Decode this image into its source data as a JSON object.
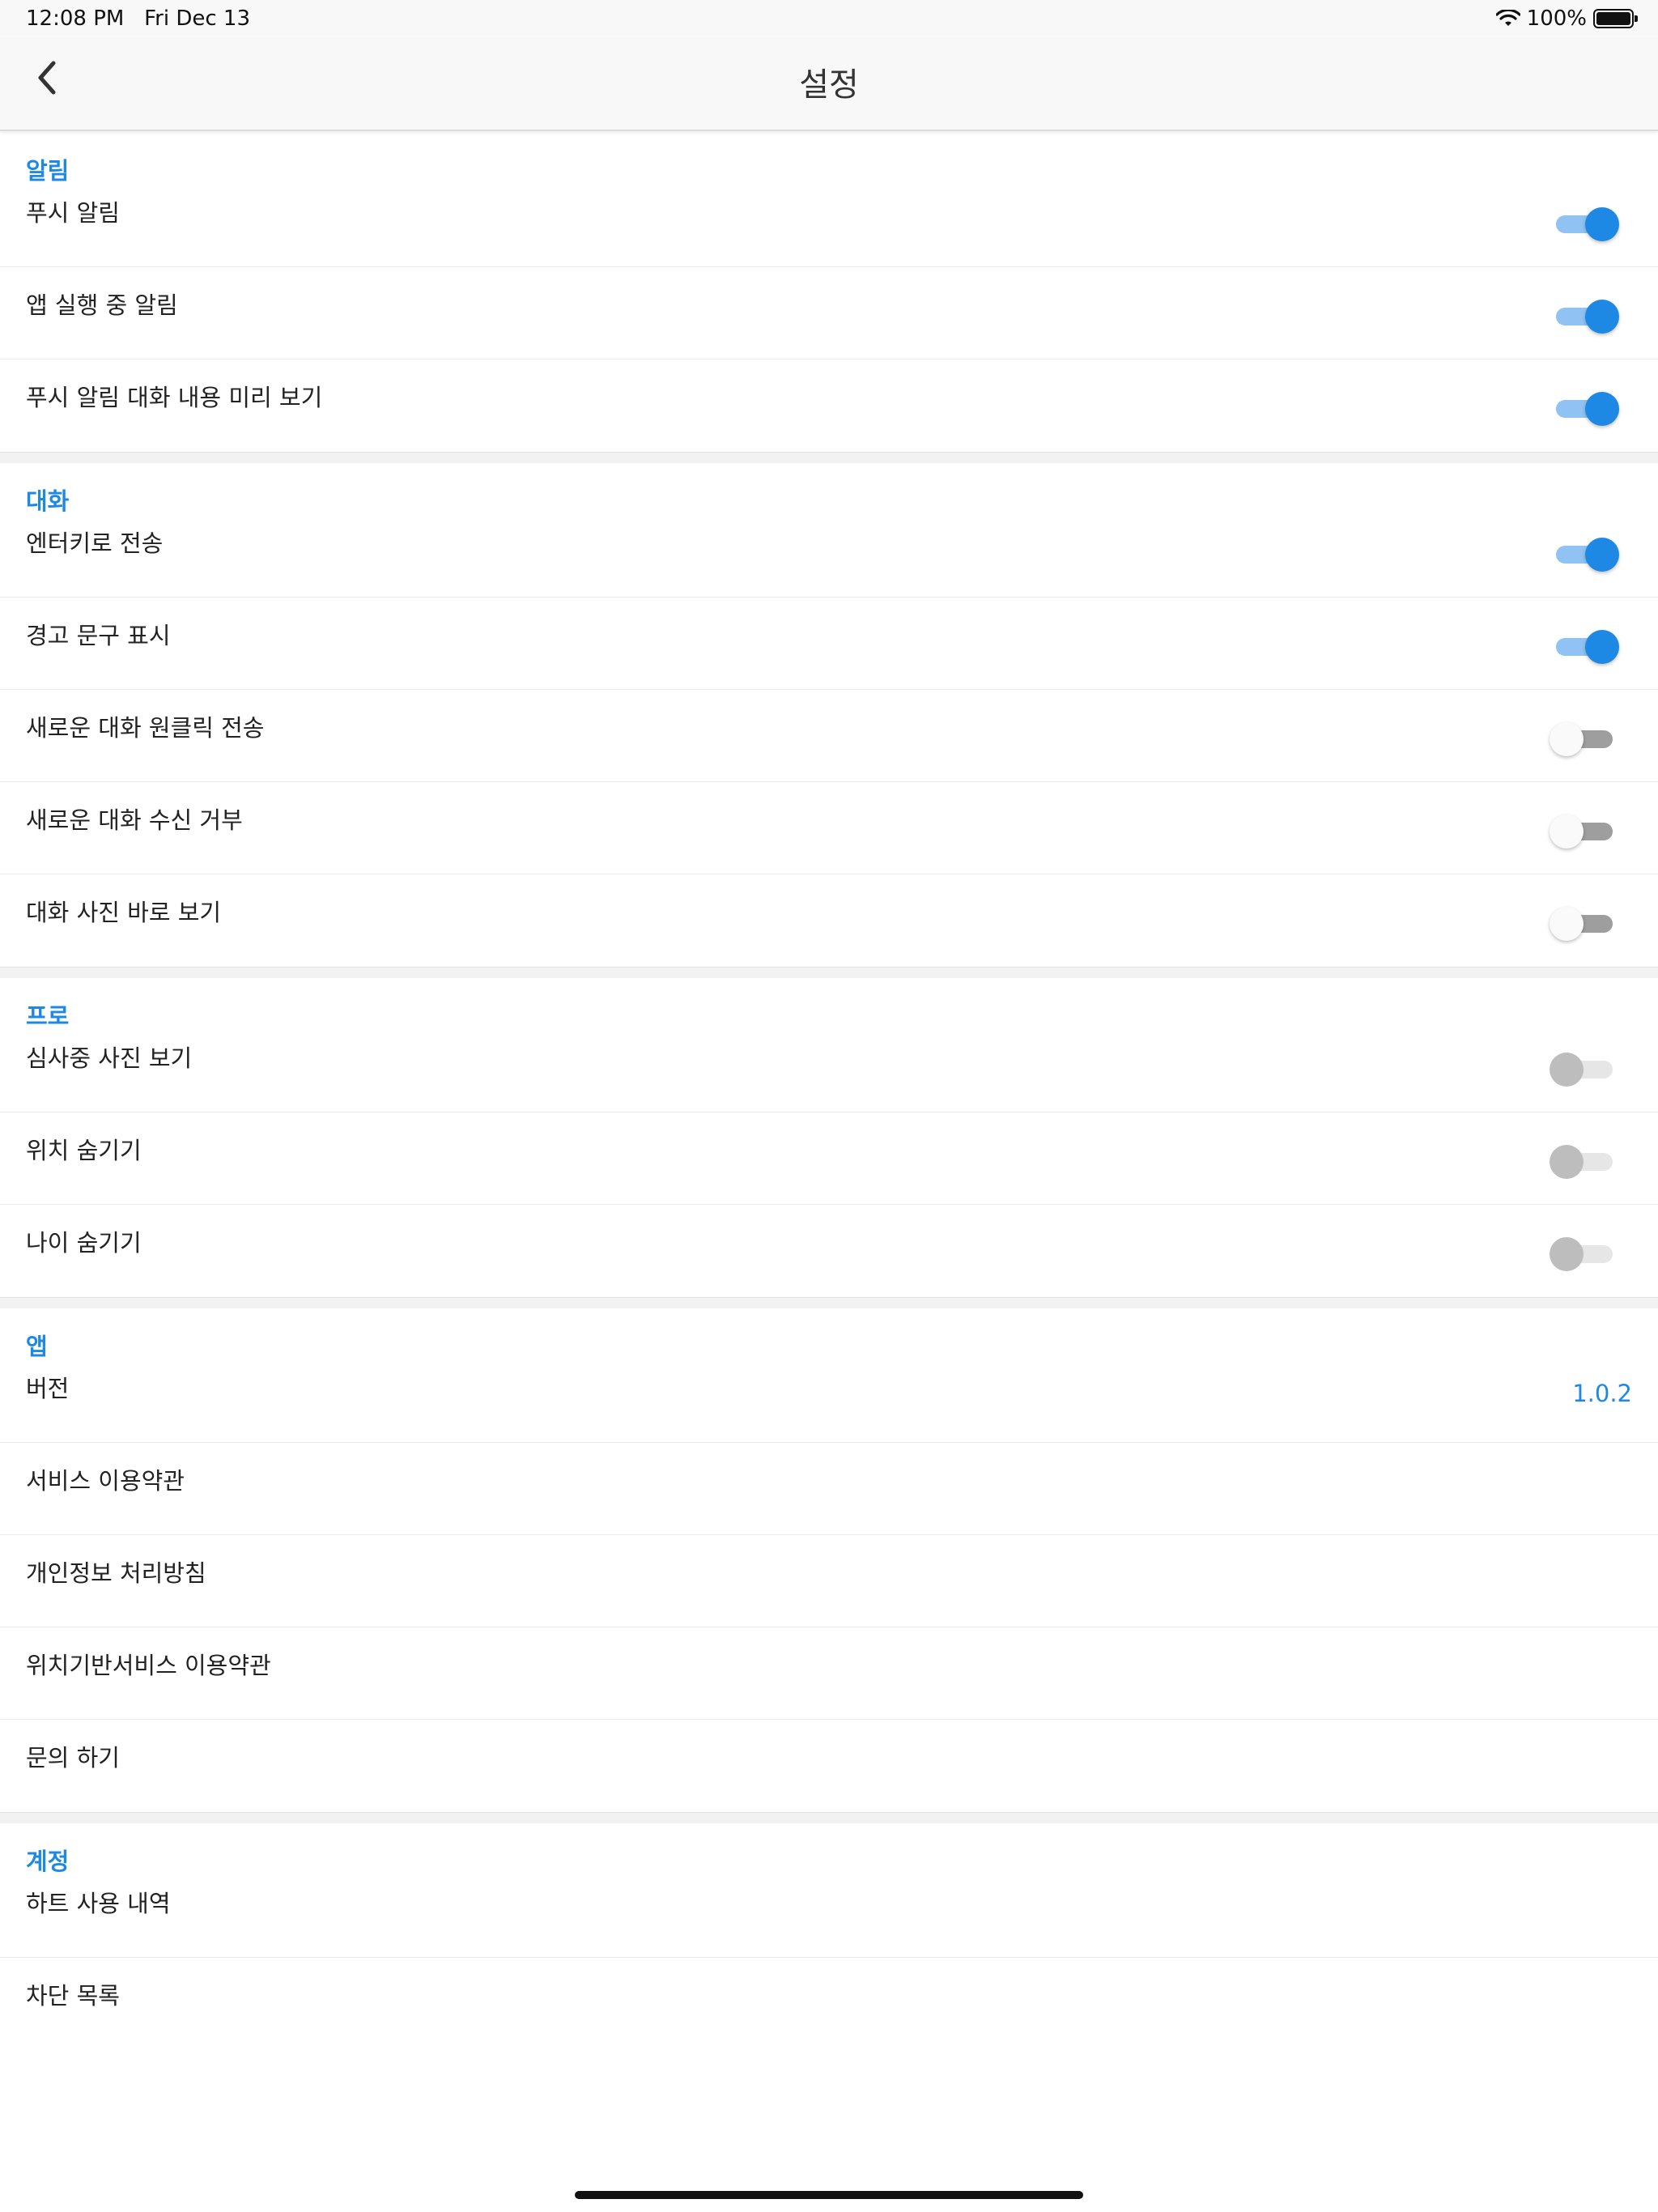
{
  "status_bar": {
    "time": "12:08 PM",
    "date": "Fri Dec 13",
    "battery": "100%"
  },
  "nav": {
    "title": "설정",
    "back_icon": "chevron-left-icon"
  },
  "colors": {
    "accent": "#1e88e5",
    "toggle_on_track": "#90c3f3",
    "toggle_off_track": "#9e9e9e",
    "toggle_disabled": "#bdbdbd"
  },
  "sections": {
    "notifications": {
      "title": "알림",
      "items": [
        {
          "label": "푸시 알림",
          "state": "on"
        },
        {
          "label": "앱 실행 중 알림",
          "state": "on"
        },
        {
          "label": "푸시 알림 대화 내용 미리 보기",
          "state": "on"
        }
      ]
    },
    "chat": {
      "title": "대화",
      "items": [
        {
          "label": "엔터키로 전송",
          "state": "on"
        },
        {
          "label": "경고 문구 표시",
          "state": "on"
        },
        {
          "label": "새로운 대화 원클릭 전송",
          "state": "off"
        },
        {
          "label": "새로운 대화 수신 거부",
          "state": "off"
        },
        {
          "label": "대화 사진 바로 보기",
          "state": "off"
        }
      ]
    },
    "pro": {
      "title": "프로",
      "items": [
        {
          "label": "심사중 사진 보기",
          "state": "disabled"
        },
        {
          "label": "위치 숨기기",
          "state": "disabled"
        },
        {
          "label": "나이 숨기기",
          "state": "disabled"
        }
      ]
    },
    "app": {
      "title": "앱",
      "version_label": "버전",
      "version_value": "1.0.2",
      "items": [
        {
          "label": "서비스 이용약관"
        },
        {
          "label": "개인정보 처리방침"
        },
        {
          "label": "위치기반서비스 이용약관"
        },
        {
          "label": "문의 하기"
        }
      ]
    },
    "account": {
      "title": "계정",
      "items": [
        {
          "label": "하트 사용 내역"
        },
        {
          "label": "차단 목록"
        }
      ]
    }
  }
}
